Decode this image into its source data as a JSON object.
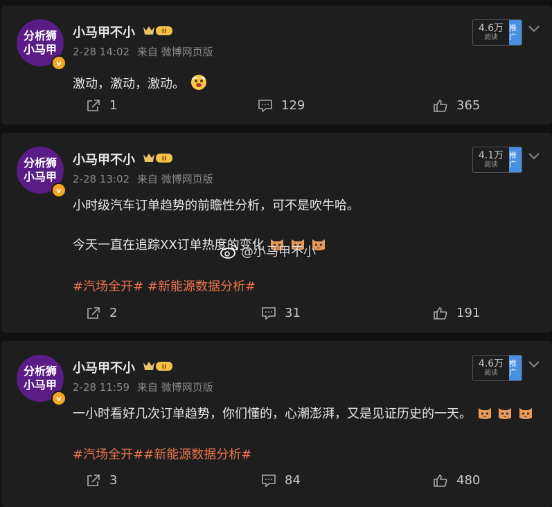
{
  "posts": [
    {
      "avatar_line1": "分析狮",
      "avatar_line2": "小马甲",
      "username": "小马甲不小",
      "time": "2-28 14:02",
      "source": "来自 微博网页版",
      "reads": "4.6万",
      "reads_label": "阅读",
      "promo_label": "推广",
      "lines": [
        "激动，激动，激动。"
      ],
      "hashtags": "",
      "reposts": "1",
      "comments": "129",
      "likes": "365"
    },
    {
      "avatar_line1": "分析狮",
      "avatar_line2": "小马甲",
      "username": "小马甲不小",
      "time": "2-28 13:02",
      "source": "来自 微博网页版",
      "reads": "4.1万",
      "reads_label": "阅读",
      "promo_label": "推广",
      "lines": [
        "小时级汽车订单趋势的前瞻性分析，可不是吹牛哈。",
        "今天一直在追踪XX订单热度的变化"
      ],
      "hashtags": "#汽场全开# #新能源数据分析#",
      "reposts": "2",
      "comments": "31",
      "likes": "191"
    },
    {
      "avatar_line1": "分析狮",
      "avatar_line2": "小马甲",
      "username": "小马甲不小",
      "time": "2-28 11:59",
      "source": "来自 微博网页版",
      "reads": "4.6万",
      "reads_label": "阅读",
      "promo_label": "推广",
      "lines": [
        "一小时看好几次订单趋势，你们懂的，心潮澎湃，又是见证历史的一天。"
      ],
      "hashtags": "#汽场全开##新能源数据分析#",
      "reposts": "3",
      "comments": "84",
      "likes": "480"
    }
  ],
  "watermark": "@小马甲不小",
  "verified_badge": "v",
  "colors": {
    "avatar_bg": "#5a1d86",
    "hashtag": "#eb7350",
    "promo": "#4a90e2",
    "verified": "#f5a623"
  }
}
